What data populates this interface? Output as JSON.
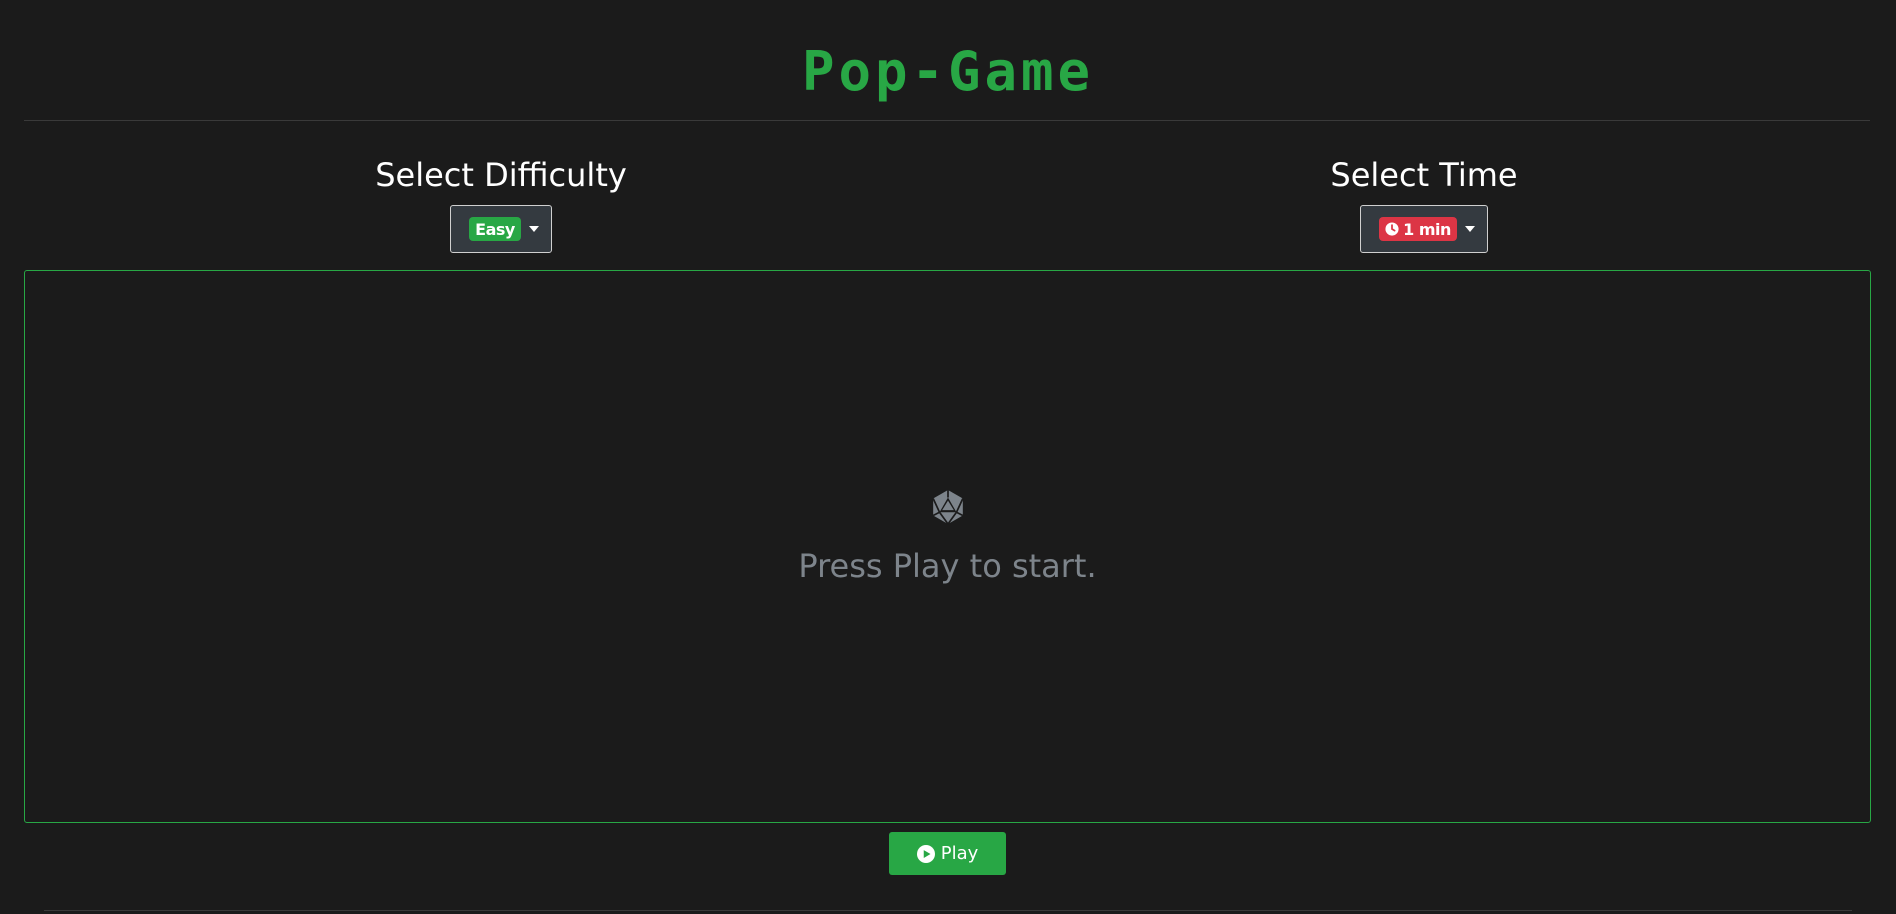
{
  "header": {
    "brand_title": "Pop-Game"
  },
  "difficulty": {
    "heading": "Select Difficulty",
    "selected": "Easy",
    "badge_color": "#28a745"
  },
  "time": {
    "heading": "Select Time",
    "selected": "1 min",
    "icon": "clock-icon",
    "badge_color": "#dc3545"
  },
  "game_area": {
    "icon": "dice-d20-icon",
    "message": "Press Play to start.",
    "border_color": "#28a745"
  },
  "play_button": {
    "label": "Play",
    "icon": "play-circle-icon",
    "color": "#28a745"
  },
  "theme": {
    "background": "#1b1b1b",
    "accent": "#28a745",
    "muted_text": "#7d848b"
  }
}
